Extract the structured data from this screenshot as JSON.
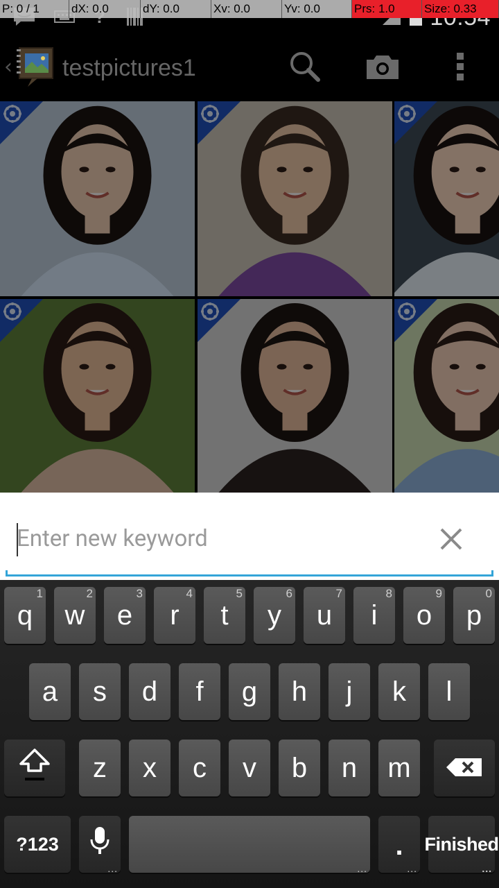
{
  "pointer_location": {
    "pointer": "P: 0 / 1",
    "dx": "dX: 0.0",
    "dy": "dY: 0.0",
    "xv": "Xv: 0.0",
    "yv": "Yv: 0.0",
    "prs": "Prs: 1.0",
    "size": "Size: 0.33"
  },
  "status_bar": {
    "time": "10:54",
    "left_icons": [
      "message-icon",
      "keyboard-icon",
      "help-icon",
      "barcode-icon"
    ],
    "right_icons": [
      "signal-icon",
      "battery-icon"
    ]
  },
  "action_bar": {
    "title": "testpictures1",
    "actions": [
      "search-icon",
      "camera-icon",
      "overflow-menu-icon"
    ]
  },
  "photo_grid": {
    "badge_color": "#1f4fb8",
    "tiles": [
      {
        "name": "photo-1",
        "bg": "#b9c7d6",
        "skin": "#e7c7ad",
        "hair": "#1a1310",
        "cloth": "#cfe0f2"
      },
      {
        "name": "photo-2",
        "bg": "#c6c0b2",
        "skin": "#e6c1a2",
        "hair": "#3a2a22",
        "cloth": "#7c4aa0"
      },
      {
        "name": "photo-3",
        "bg": "#3c4a55",
        "skin": "#f0cfb8",
        "hair": "#181210",
        "cloth": "#dfe7ef"
      },
      {
        "name": "photo-4",
        "bg": "#5d7e3a",
        "skin": "#e2b896",
        "hair": "#2a1a14",
        "cloth": "#d9b8a0"
      },
      {
        "name": "photo-5",
        "bg": "#cfcfcf",
        "skin": "#e1b79a",
        "hair": "#1c1412",
        "cloth": "#2a2220"
      },
      {
        "name": "photo-6",
        "bg": "#c7d7b0",
        "skin": "#ebc9b2",
        "hair": "#2b1c16",
        "cloth": "#8db0d8"
      }
    ]
  },
  "keyword_input": {
    "placeholder": "Enter new keyword",
    "value": "",
    "accent": "#33a4d8"
  },
  "keyboard": {
    "row1": [
      {
        "label": "q",
        "hint": "1"
      },
      {
        "label": "w",
        "hint": "2"
      },
      {
        "label": "e",
        "hint": "3"
      },
      {
        "label": "r",
        "hint": "4"
      },
      {
        "label": "t",
        "hint": "5"
      },
      {
        "label": "y",
        "hint": "6"
      },
      {
        "label": "u",
        "hint": "7"
      },
      {
        "label": "i",
        "hint": "8"
      },
      {
        "label": "o",
        "hint": "9"
      },
      {
        "label": "p",
        "hint": "0"
      }
    ],
    "row2": [
      "a",
      "s",
      "d",
      "f",
      "g",
      "h",
      "j",
      "k",
      "l"
    ],
    "row3": [
      "z",
      "x",
      "c",
      "v",
      "b",
      "n",
      "m"
    ],
    "symbols_label": "?123",
    "period_label": ".",
    "enter_label": "Finished",
    "shift_icon": "shift-icon",
    "backspace_icon": "backspace-icon",
    "mic_icon": "microphone-icon"
  }
}
